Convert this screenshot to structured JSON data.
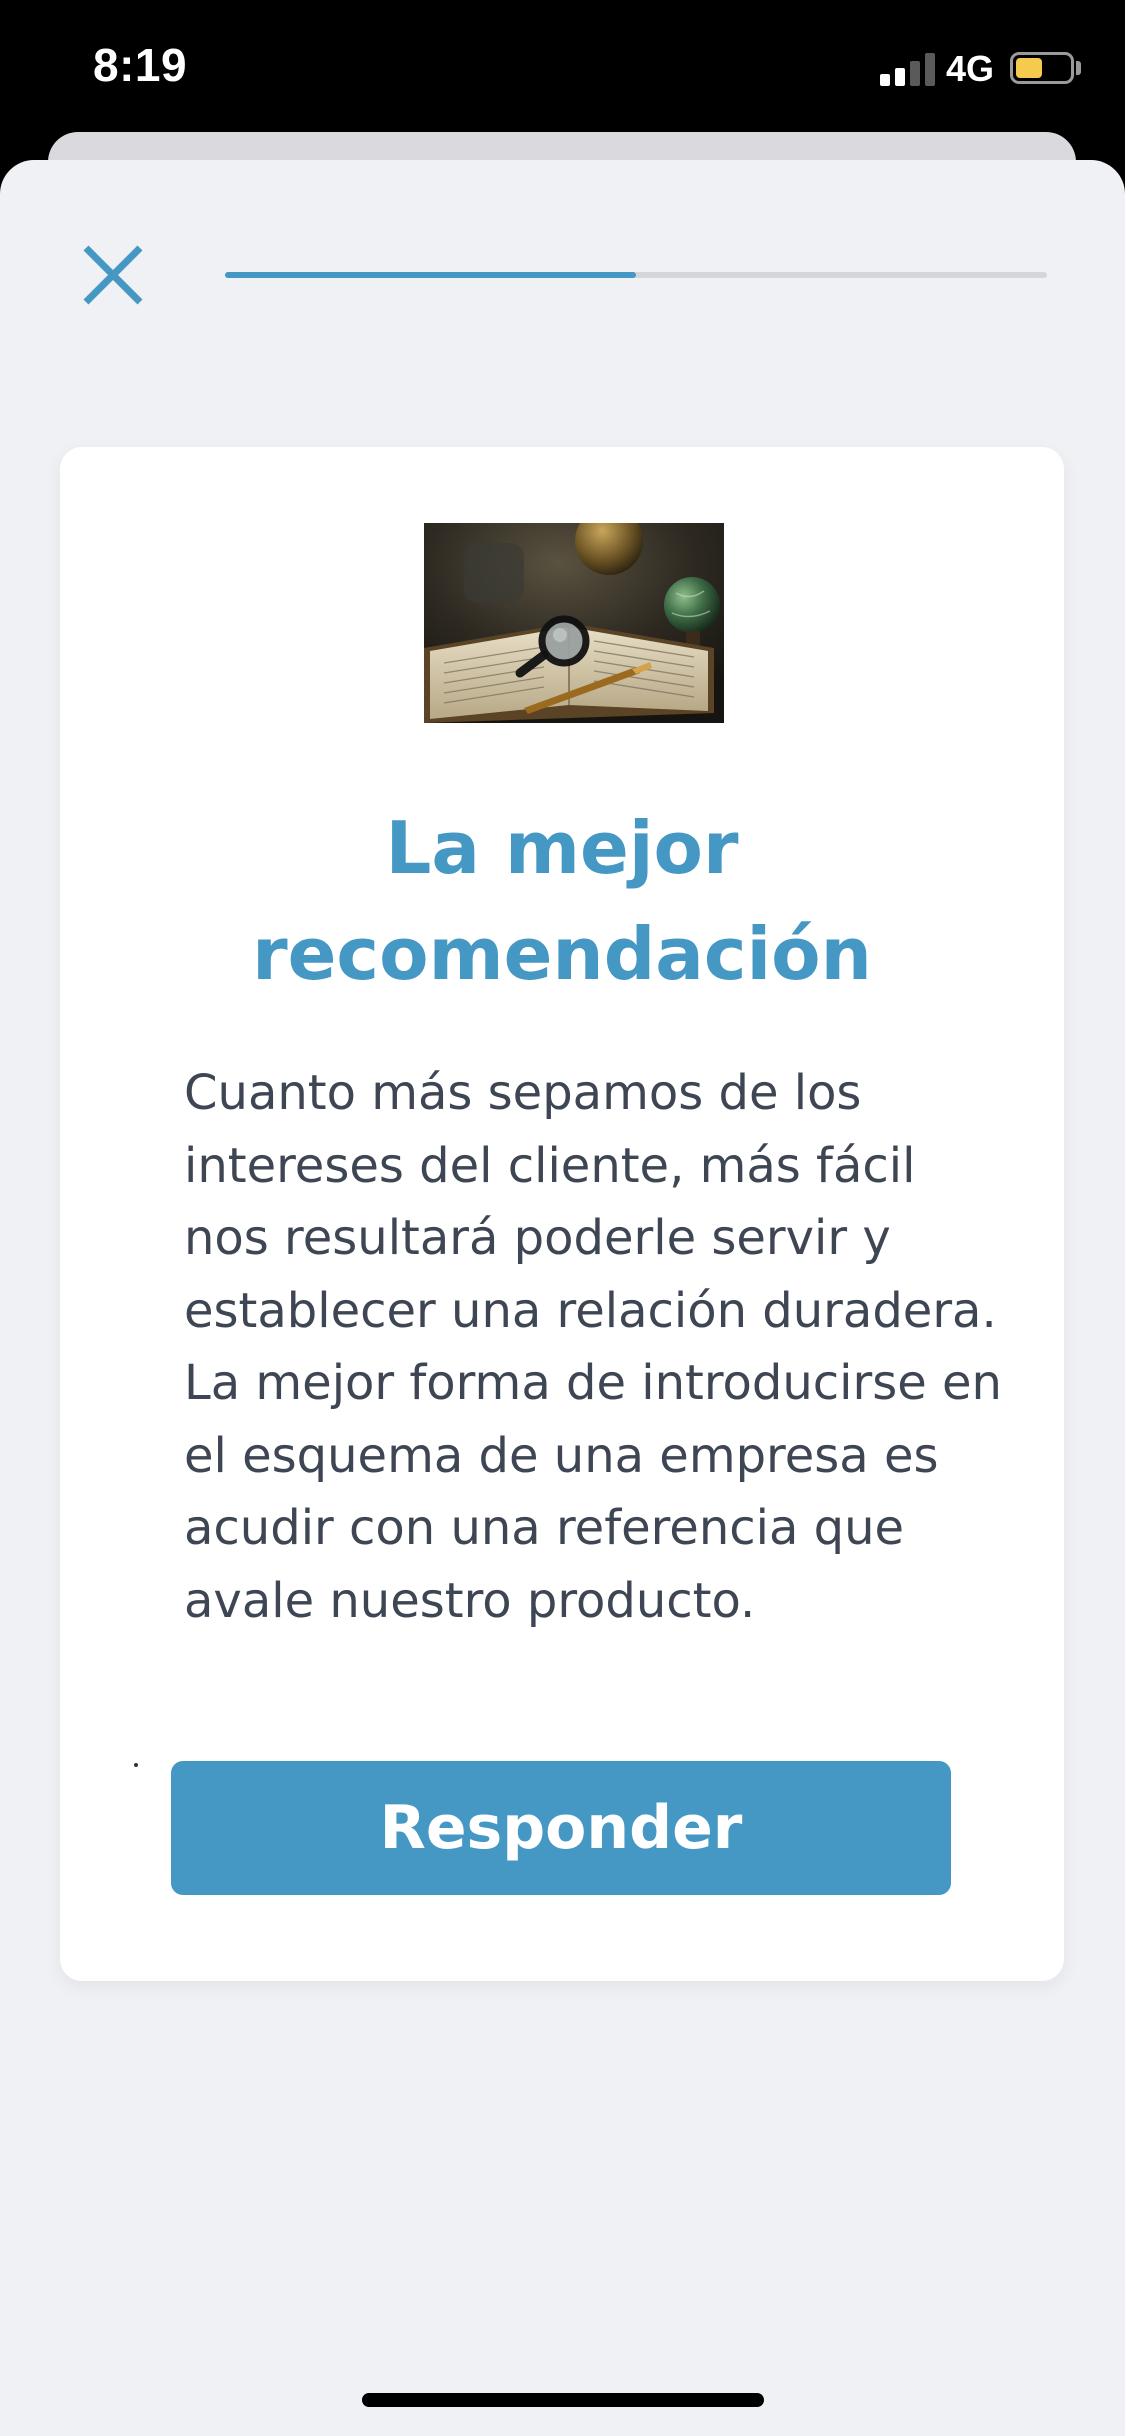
{
  "status_bar": {
    "time": "8:19",
    "network": "4G",
    "signal_bars_active": 2,
    "signal_bars_total": 4,
    "battery_level": 0.5,
    "battery_color": "#f4cb4f"
  },
  "header": {
    "close_icon": "close-icon",
    "progress": 0.5
  },
  "card": {
    "image_icon": "magnifying-glass-book-image",
    "title": "La mejor recomendación",
    "body": "Cuanto más sepamos de los intereses del cliente, más fácil nos resultará poderle servir y establecer una relación duradera. La mejor forma de introducirse en el esquema de una empresa es acudir con una referencia que avale nuestro producto.",
    "button_label": "Responder"
  },
  "colors": {
    "accent": "#4597c4",
    "sheet_background": "#f0f1f5",
    "card_background": "#ffffff",
    "body_text": "#3e4654"
  }
}
